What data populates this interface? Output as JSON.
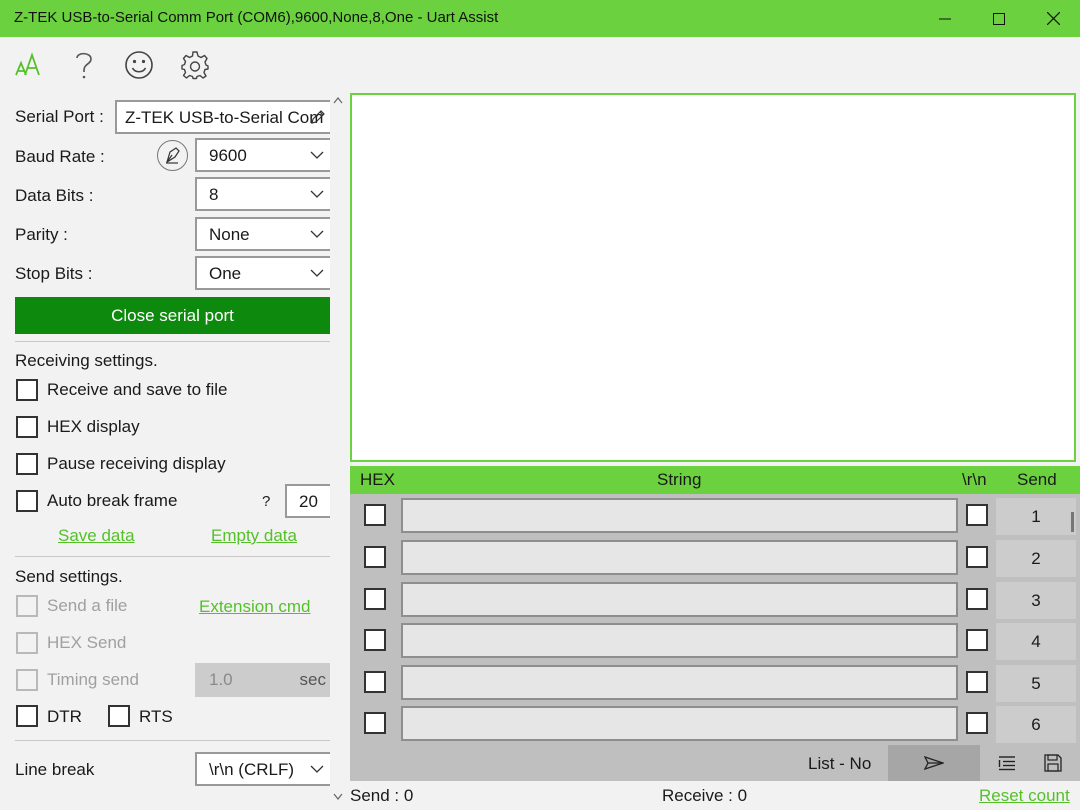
{
  "window": {
    "title": "Z-TEK USB-to-Serial Comm Port (COM6),9600,None,8,One - Uart Assist",
    "accent_color": "#6cd13f",
    "button_color": "#0d8a0d"
  },
  "toolbar": {
    "icons": [
      "font-size-icon",
      "help-icon",
      "smiley-icon",
      "gear-icon"
    ]
  },
  "serial": {
    "port_label": "Serial Port :",
    "port_value": "Z-TEK USB-to-Serial Com",
    "baud_label": "Baud Rate :",
    "baud_value": "9600",
    "databits_label": "Data Bits :",
    "databits_value": "8",
    "parity_label": "Parity :",
    "parity_value": "None",
    "stopbits_label": "Stop Bits :",
    "stopbits_value": "One",
    "close_button": "Close serial port"
  },
  "receiving": {
    "heading": "Receiving settings.",
    "save_to_file": "Receive and save to file",
    "hex_display": "HEX display",
    "pause_display": "Pause receiving display",
    "auto_break": "Auto break frame",
    "help_mark": "?",
    "auto_break_value": "20",
    "save_data_link": "Save data",
    "empty_data_link": "Empty data"
  },
  "sending": {
    "heading": "Send settings.",
    "send_file": "Send a file",
    "extension_link": "Extension cmd",
    "hex_send": "HEX Send",
    "timing_send": "Timing send",
    "timing_value": "1.0",
    "timing_unit": "sec",
    "dtr": "DTR",
    "rts": "RTS",
    "line_break_label": "Line break",
    "line_break_value": "\\r\\n (CRLF)"
  },
  "send_list": {
    "header_hex": "HEX",
    "header_string": "String",
    "header_crlf": "\\r\\n",
    "header_send": "Send",
    "rows": [
      {
        "button": "1"
      },
      {
        "button": "2"
      },
      {
        "button": "3"
      },
      {
        "button": "4"
      },
      {
        "button": "5"
      },
      {
        "button": "6"
      }
    ],
    "list_label": "List - No"
  },
  "status": {
    "send": "Send : 0",
    "receive": "Receive : 0",
    "reset_link": "Reset count"
  }
}
